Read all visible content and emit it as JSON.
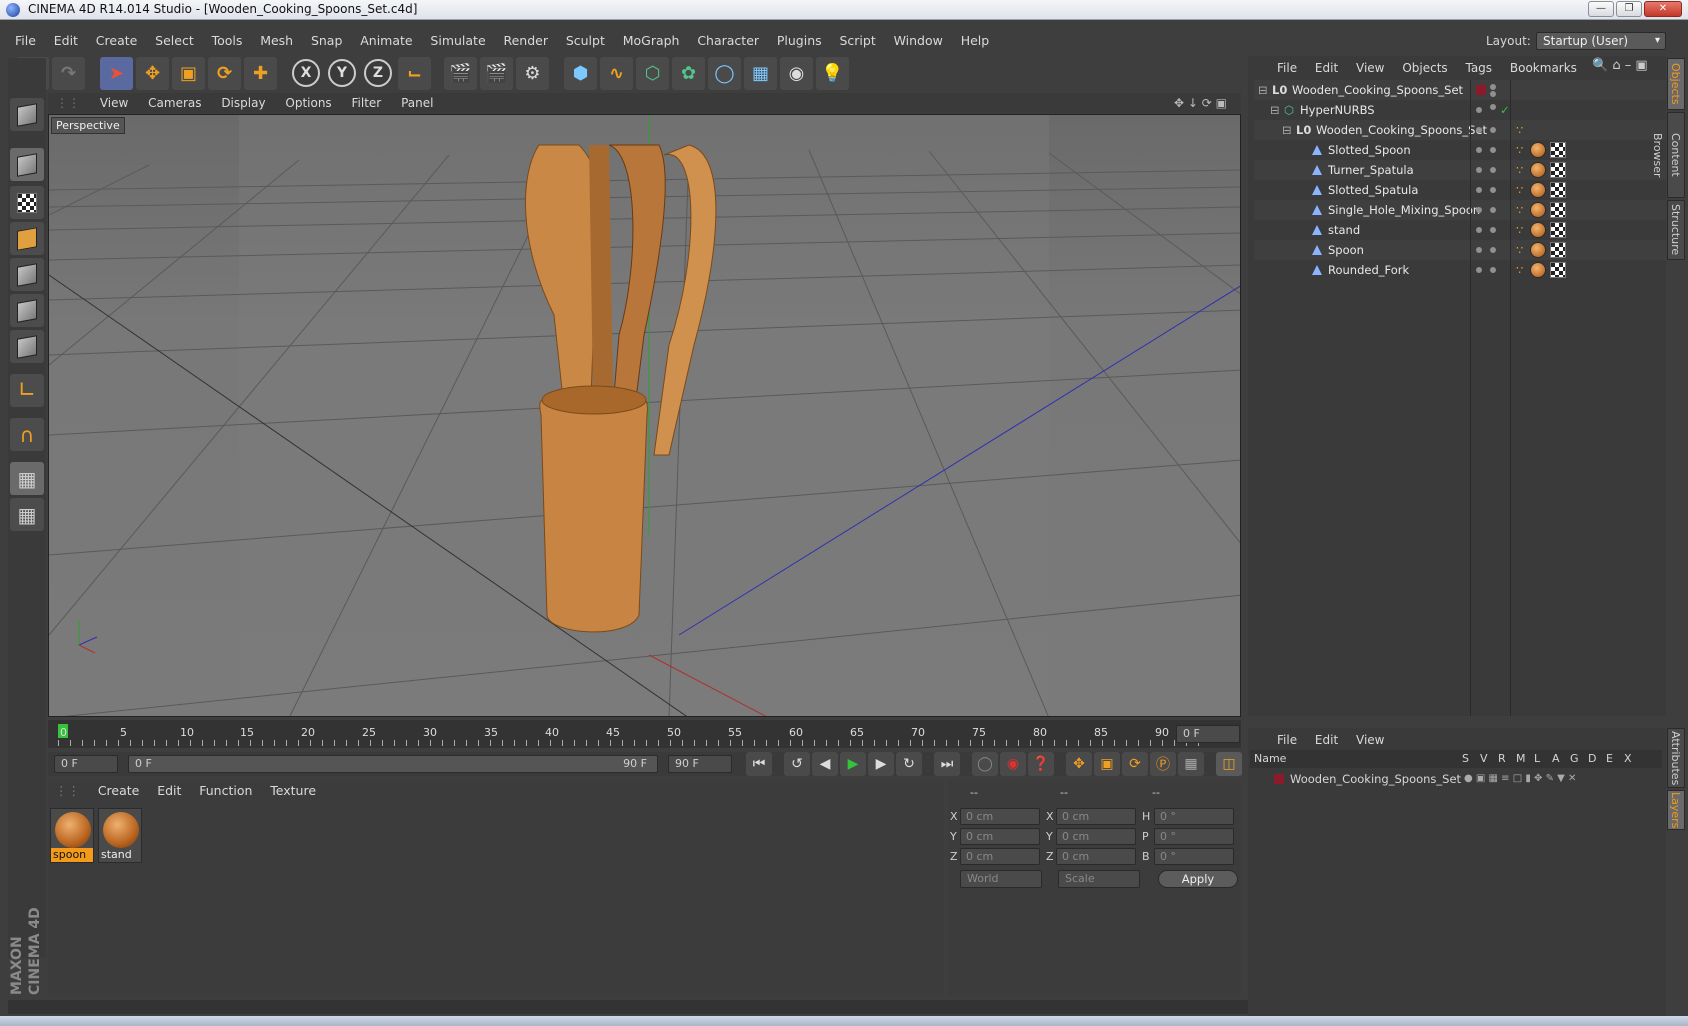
{
  "window": {
    "title": "CINEMA 4D R14.014 Studio - [Wooden_Cooking_Spoons_Set.c4d]",
    "controls": [
      "minimize",
      "restore",
      "close"
    ]
  },
  "menubar": {
    "items": [
      "File",
      "Edit",
      "Create",
      "Select",
      "Tools",
      "Mesh",
      "Snap",
      "Animate",
      "Simulate",
      "Render",
      "Sculpt",
      "MoGraph",
      "Character",
      "Plugins",
      "Script",
      "Window",
      "Help"
    ]
  },
  "layout": {
    "label": "Layout:",
    "value": "Startup (User)"
  },
  "toolbar": {
    "icons": [
      "undo-icon",
      "redo-icon",
      "select-icon",
      "move-icon",
      "scale-icon",
      "rotate-icon",
      "add-icon",
      "x-axis-icon",
      "y-axis-icon",
      "z-axis-icon",
      "world-coord-icon",
      "render-view-icon",
      "render-picture-queue-icon",
      "render-settings-icon",
      "cube-primitive-icon",
      "spline-icon",
      "nurbs-icon",
      "array-icon",
      "deformer-icon",
      "environment-icon",
      "camera-icon",
      "light-icon"
    ],
    "axis_labels": [
      "X",
      "Y",
      "Z"
    ]
  },
  "viewport": {
    "menu": [
      "View",
      "Cameras",
      "Display",
      "Options",
      "Filter",
      "Panel"
    ],
    "label": "Perspective"
  },
  "timeline": {
    "ticks": [
      "0",
      "5",
      "10",
      "15",
      "20",
      "25",
      "30",
      "35",
      "40",
      "45",
      "50",
      "55",
      "60",
      "65",
      "70",
      "75",
      "80",
      "85",
      "90"
    ],
    "current_frame": "0 F",
    "start_field": "0 F",
    "range_start": "0 F",
    "range_end": "90 F",
    "end_field": "90 F"
  },
  "materials": {
    "menu": [
      "Create",
      "Edit",
      "Function",
      "Texture"
    ],
    "items": [
      {
        "name": "spoon",
        "selected": true
      },
      {
        "name": "stand",
        "selected": false
      }
    ]
  },
  "coordinates": {
    "headers": [
      "--",
      "--",
      "--"
    ],
    "rows": [
      {
        "a": "X",
        "a_val": "0 cm",
        "b": "X",
        "b_val": "0 cm",
        "c": "H",
        "c_val": "0 °"
      },
      {
        "a": "Y",
        "a_val": "0 cm",
        "b": "Y",
        "b_val": "0 cm",
        "c": "P",
        "c_val": "0 °"
      },
      {
        "a": "Z",
        "a_val": "0 cm",
        "b": "Z",
        "b_val": "0 cm",
        "c": "B",
        "c_val": "0 °"
      }
    ],
    "mode": "World",
    "transform": "Scale",
    "apply_label": "Apply"
  },
  "objects": {
    "menu": [
      "File",
      "Edit",
      "View",
      "Objects",
      "Tags",
      "Bookmarks"
    ],
    "tree": [
      {
        "name": "Wooden_Cooking_Spoons_Set",
        "indent": 0,
        "kind": "null"
      },
      {
        "name": "HyperNURBS",
        "indent": 1,
        "kind": "nurbs"
      },
      {
        "name": "Wooden_Cooking_Spoons_Set",
        "indent": 2,
        "kind": "null"
      },
      {
        "name": "Slotted_Spoon",
        "indent": 3,
        "kind": "poly"
      },
      {
        "name": "Turner_Spatula",
        "indent": 3,
        "kind": "poly"
      },
      {
        "name": "Slotted_Spatula",
        "indent": 3,
        "kind": "poly"
      },
      {
        "name": "Single_Hole_Mixing_Spoon",
        "indent": 3,
        "kind": "poly"
      },
      {
        "name": "stand",
        "indent": 3,
        "kind": "poly"
      },
      {
        "name": "Spoon",
        "indent": 3,
        "kind": "poly"
      },
      {
        "name": "Rounded_Fork",
        "indent": 3,
        "kind": "poly"
      }
    ]
  },
  "layers": {
    "menu": [
      "File",
      "Edit",
      "View"
    ],
    "columns": [
      "Name",
      "S",
      "V",
      "R",
      "M",
      "L",
      "A",
      "G",
      "D",
      "E",
      "X"
    ],
    "rows": [
      {
        "name": "Wooden_Cooking_Spoons_Set"
      }
    ]
  },
  "side_tabs": [
    "Objects",
    "Content Browser",
    "Structure",
    "Attributes",
    "Layers"
  ],
  "logo": "MAXON CINEMA 4D",
  "colors": {
    "accent": "#f29a1a",
    "background": "#3e3e3e",
    "layer_color": "#8b1a2b"
  }
}
